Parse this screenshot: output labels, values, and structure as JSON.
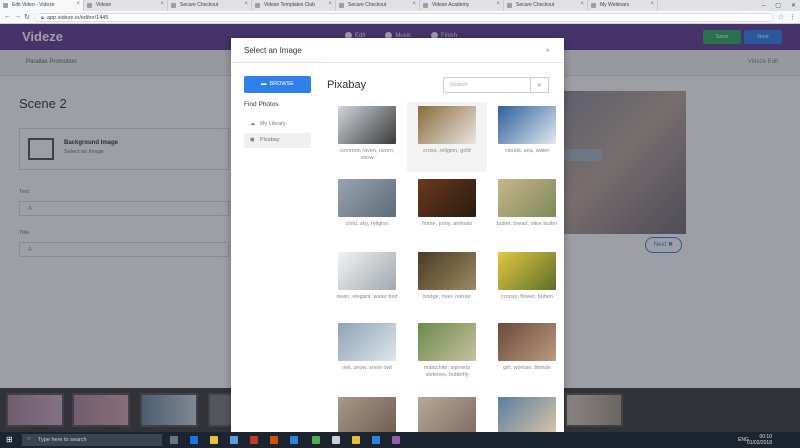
{
  "browser": {
    "tabs": [
      {
        "label": "Edit Video - Videze",
        "active": true
      },
      {
        "label": "Videze"
      },
      {
        "label": "Secure Checkout"
      },
      {
        "label": "Videze Templates Club"
      },
      {
        "label": "Secure Checkout"
      },
      {
        "label": "Videze Academy"
      },
      {
        "label": "Secure Checkout"
      },
      {
        "label": "My Webinars"
      }
    ],
    "url": "app.videze.io/editor/1445"
  },
  "app": {
    "logo": "Videze",
    "steps": [
      "Edit",
      "Music",
      "Finish"
    ],
    "save_label": "Save",
    "next_label": "Next",
    "project_name": "Parallax Promotion",
    "subbar_right": "Videze Edit"
  },
  "editor": {
    "scene_title": "Scene 2",
    "bg_title": "Background Image",
    "bg_sub": "Select an Image",
    "text_label": "Text",
    "title_label": "Title",
    "field_glyph": "A",
    "preview_next": "Next"
  },
  "modal": {
    "title": "Select an Image",
    "close": "×",
    "browse_label": "BROWSE",
    "find_photos": "Find Photos",
    "sources": [
      "My Library",
      "Pixabay"
    ],
    "provider_title": "Pixabay",
    "search_placeholder": "Search",
    "images": [
      {
        "caption": "common raven, raven, snow",
        "colors": [
          "#cfd6dc",
          "#3a3a3a"
        ]
      },
      {
        "caption": "cross, religion, gold",
        "colors": [
          "#8a6a3c",
          "#e9e6df"
        ],
        "selected": true
      },
      {
        "caption": "clouds, sea, water",
        "colors": [
          "#2d5f9a",
          "#dfe8f0"
        ]
      },
      {
        "caption": "child, sky, religion",
        "colors": [
          "#98a4b0",
          "#5e6a76"
        ]
      },
      {
        "caption": "horse, pony, animals",
        "colors": [
          "#6b3a1e",
          "#2a1a10"
        ]
      },
      {
        "caption": "butter, bread, olive butter",
        "colors": [
          "#c9b48a",
          "#7c8b5a"
        ]
      },
      {
        "caption": "swan, elegant, water bird",
        "colors": [
          "#f2f2f2",
          "#a0a8b0"
        ]
      },
      {
        "caption": "bridge, river, nature",
        "colors": [
          "#4a3a26",
          "#9a8a62"
        ]
      },
      {
        "caption": "crocus, flower, bühen",
        "colors": [
          "#e2c840",
          "#5e6e2a"
        ]
      },
      {
        "caption": "owl, snow, snow owl",
        "colors": [
          "#8ea3b8",
          "#dfe5ea"
        ]
      },
      {
        "caption": "malachite, siproeta stelenes, butterfly",
        "colors": [
          "#6a8a4a",
          "#c8c0a0"
        ]
      },
      {
        "caption": "girl, woman, blonde",
        "colors": [
          "#6a4a3a",
          "#b99a7e"
        ]
      },
      {
        "caption": "",
        "colors": [
          "#a89888",
          "#6e5e50"
        ]
      },
      {
        "caption": "",
        "colors": [
          "#b8a898",
          "#7e6e60"
        ]
      },
      {
        "caption": "",
        "colors": [
          "#5a7ea0",
          "#d9c4a8"
        ]
      }
    ]
  },
  "taskbar": {
    "search_placeholder": "Type here to search",
    "lang": "ENG",
    "time": "00:10",
    "date": "01/03/2018"
  }
}
